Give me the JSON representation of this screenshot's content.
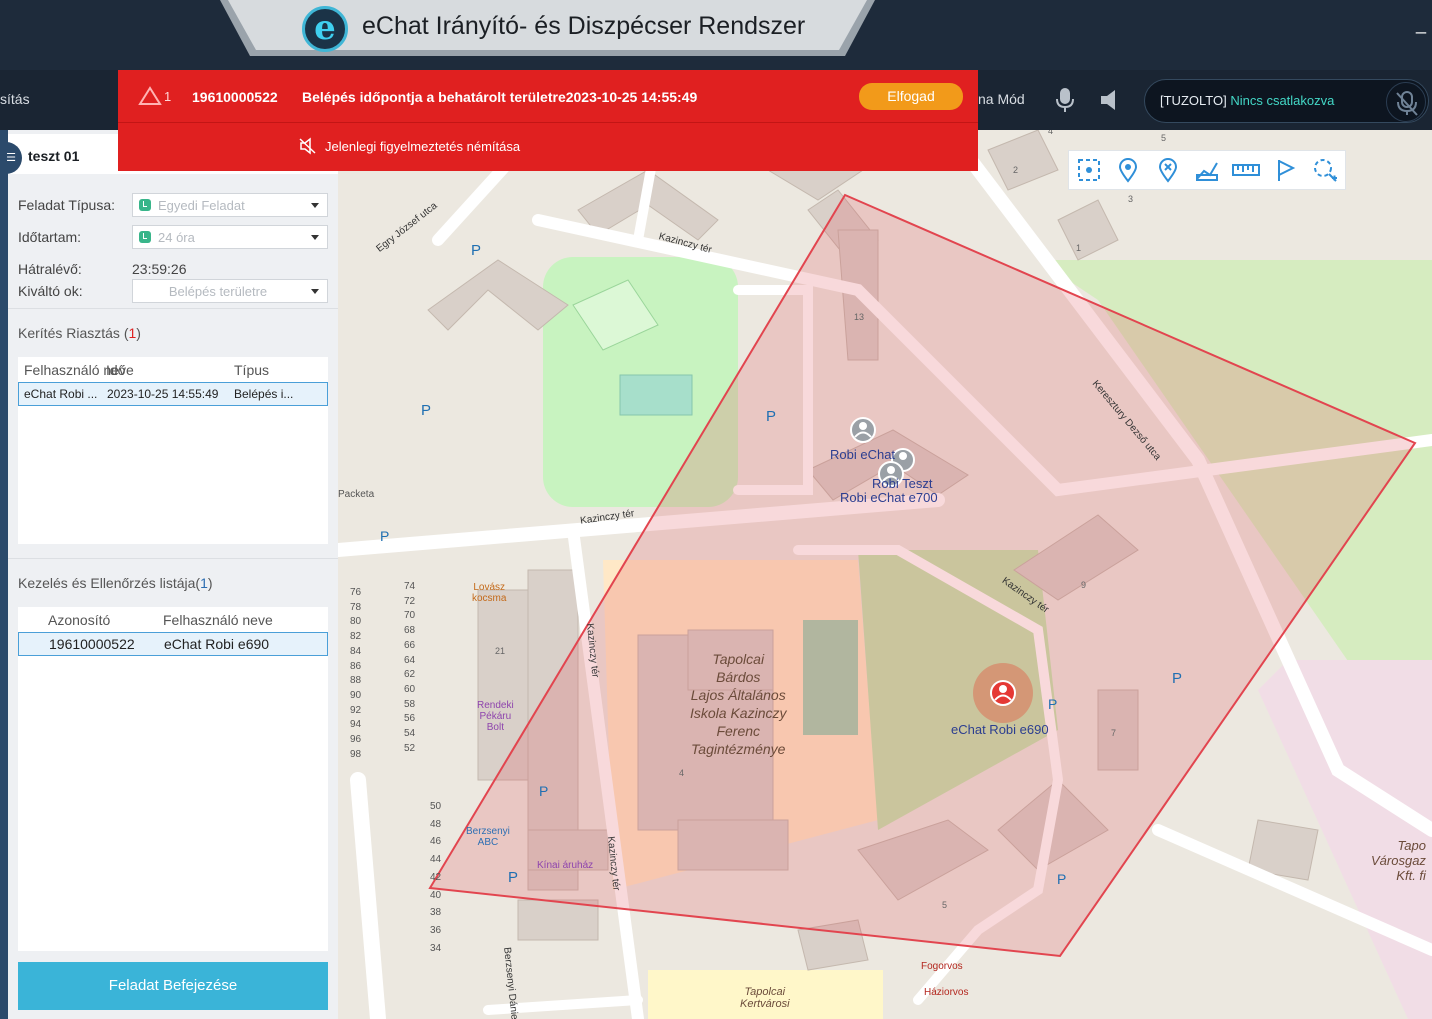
{
  "app": {
    "title": "eChat Irányító-  és Diszpécser Rendszer",
    "logo_letter": "e",
    "window_minimize": "_"
  },
  "toolbar": {
    "menu_left": "sítás",
    "menu_mode": "na Mód",
    "icons": [
      "microphone-icon",
      "speaker-icon"
    ],
    "status": {
      "prefix": "[TUZOLTO]",
      "text": "Nincs csatlakozva"
    }
  },
  "alert": {
    "count": "1",
    "device_id": "19610000522",
    "message": "Belépés időpontja a behatárolt területre2023-10-25 14:55:49",
    "accept_label": "Elfogad",
    "mute_label": "Jelenlegi figyelmeztetés némítása",
    "color": "#e02020",
    "accent": "#f29a1a"
  },
  "panel": {
    "tab_title": "teszt 01",
    "form": {
      "task_type_label": "Feladat Típusa:",
      "task_type_value": "Egyedi Feladat",
      "duration_label": "Időtartam:",
      "duration_value": "24 óra",
      "remaining_label": "Hátralévő:",
      "remaining_value": "23:59:26",
      "trigger_label": "Kiváltó ok:",
      "trigger_value": "Belépés területre"
    },
    "fence_alarm": {
      "title": "Kerítés Riasztás",
      "count": "1",
      "columns": [
        "Felhasználó neve",
        "Idő",
        "Típus"
      ],
      "rows": [
        {
          "user": "eChat Robi ...",
          "time": "2023-10-25 14:55:49",
          "type": "Belépés i..."
        }
      ]
    },
    "check_list": {
      "title": "Kezelés és Ellenőrzés listája",
      "count": "1",
      "columns": [
        "Azonosító",
        "Felhasználó neve"
      ],
      "rows": [
        {
          "id": "19610000522",
          "user": "eChat Robi e690"
        }
      ]
    },
    "finish_button": "Feladat Befejezése",
    "accent": "#3ab4d8"
  },
  "map": {
    "tools": [
      "select-area-icon",
      "location-pin-icon",
      "delete-pin-icon",
      "route-icon",
      "ruler-icon",
      "flag-icon",
      "zoom-area-icon"
    ],
    "streets": {
      "egry": "Egry József utca",
      "kazinczy_ter_1": "Kazinczy tér",
      "kazinczy_ter_2": "Kazinczy tér",
      "kazinczy_ter_3": "Kazinczy tér",
      "kazinczy_ter_v1": "Kazinczy tér",
      "kazinczy_ter_v2": "Kazinczy tér",
      "keresztury": "Keresztury Dezső utca",
      "berzsenyi": "Berzsenyi Dánie"
    },
    "pois": {
      "school": [
        "Tapolcai",
        "Bárdos",
        "Lajos Általános",
        "Iskola Kazinczy",
        "Ferenc",
        "Tagintézménye"
      ],
      "kertvarosi": [
        "Tapolcai",
        "Kertvárosi"
      ],
      "varosgaz": [
        "Tapo",
        "Városgaz",
        "Kft. fi"
      ],
      "lovasz": [
        "Lovász",
        "kocsma"
      ],
      "pekaru": [
        "Rendeki",
        "Pékáru",
        "Bolt"
      ],
      "berzsenyi_abc": [
        "Berzsenyi",
        "ABC"
      ],
      "kinai": "Kínai áruház",
      "fogorvos": "Fogorvos",
      "haziorvos": "Háziorvos",
      "packeta": "Packeta"
    },
    "users": {
      "robi_echat": "Robi eChat",
      "robi_teszt": "Robi Teszt",
      "robi_e700": "Robi eChat e700",
      "robi_e690": "eChat Robi e690"
    },
    "parking": "P",
    "house_numbers": {
      "left_col": [
        "76",
        "78",
        "80",
        "82",
        "84",
        "86",
        "88",
        "90",
        "92",
        "94",
        "96",
        "98"
      ],
      "right_col": [
        "74",
        "72",
        "70",
        "68",
        "66",
        "64",
        "62",
        "60",
        "58",
        "56",
        "54",
        "52"
      ],
      "bottom_col": [
        "50",
        "48",
        "46",
        "44",
        "42",
        "40",
        "38",
        "36",
        "34"
      ],
      "buildings": [
        "13",
        "9",
        "7",
        "5",
        "4",
        "21",
        "2",
        "3",
        "1",
        "5",
        "4"
      ]
    }
  }
}
